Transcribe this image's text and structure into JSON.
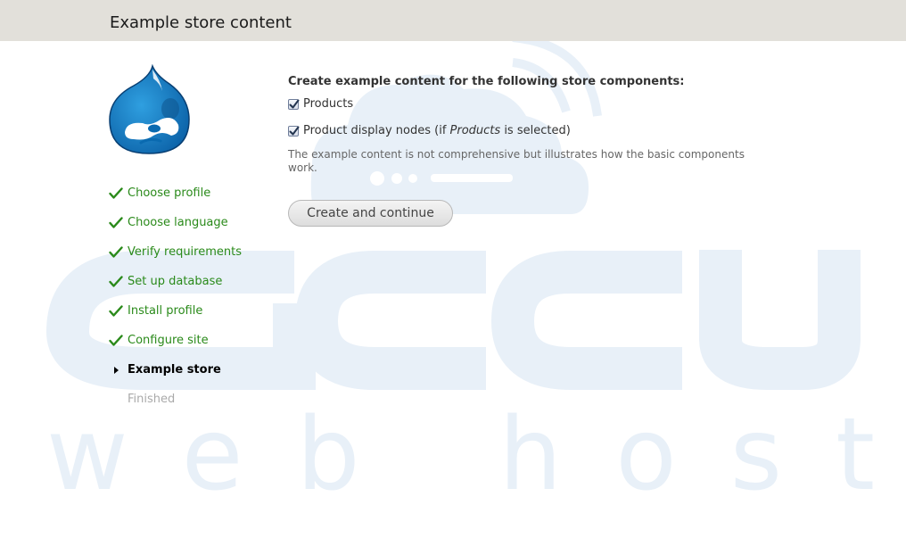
{
  "header": {
    "title": "Example store content"
  },
  "logo": {
    "icon": "drupal-drop-logo",
    "color": "#0a77c1"
  },
  "tasks": [
    {
      "label": "Choose profile",
      "state": "done"
    },
    {
      "label": "Choose language",
      "state": "done"
    },
    {
      "label": "Verify requirements",
      "state": "done"
    },
    {
      "label": "Set up database",
      "state": "done"
    },
    {
      "label": "Install profile",
      "state": "done"
    },
    {
      "label": "Configure site",
      "state": "done"
    },
    {
      "label": "Example store",
      "state": "active"
    },
    {
      "label": "Finished",
      "state": "pending"
    }
  ],
  "form": {
    "heading": "Create example content for the following store components:",
    "products": {
      "label": "Products",
      "checked": true
    },
    "product_display": {
      "label_before": "Product display nodes (if ",
      "label_em": "Products",
      "label_after": " is selected)",
      "checked": true
    },
    "description": "The example content is not comprehensive but illustrates how the basic components work.",
    "submit_label": "Create and continue"
  },
  "watermark": {
    "logo_text": "accu",
    "tagline": "web hosting",
    "color": "#e8f0f8"
  },
  "colors": {
    "header_bg": "#e2e0da",
    "task_done": "#2a8a1a",
    "task_pending": "#aaaaaa"
  }
}
